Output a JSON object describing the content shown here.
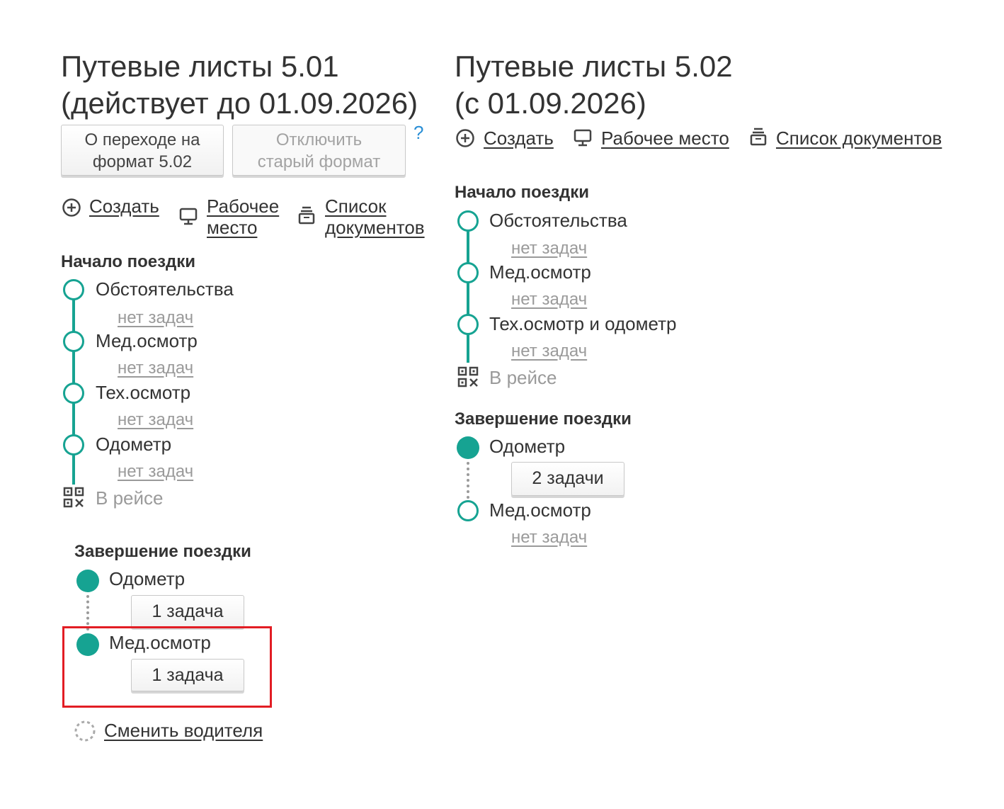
{
  "left": {
    "title_line1": "Путевые листы 5.01",
    "title_line2": "(действует до 01.09.2026)",
    "btn_transition_line1": "О переходе на",
    "btn_transition_line2": "формат 5.02",
    "btn_disable_line1": "Отключить",
    "btn_disable_line2": "старый формат",
    "help": "?",
    "create": "Создать",
    "workplace_line1": "Рабочее",
    "workplace_line2": "место",
    "doclist_line1": "Список",
    "doclist_line2": "документов",
    "start_section": "Начало поездки",
    "start_steps": [
      {
        "label": "Обстоятельства",
        "tasks": "нет задач"
      },
      {
        "label": "Мед.осмотр",
        "tasks": "нет задач"
      },
      {
        "label": "Тех.осмотр",
        "tasks": "нет задач"
      },
      {
        "label": "Одометр",
        "tasks": "нет задач"
      }
    ],
    "in_trip": "В рейсе",
    "end_section": "Завершение поездки",
    "end_steps": [
      {
        "label": "Одометр",
        "tasks": "1 задача"
      },
      {
        "label": "Мед.осмотр",
        "tasks": "1 задача"
      }
    ],
    "change_driver": "Сменить водителя"
  },
  "right": {
    "title_line1": "Путевые листы 5.02",
    "title_line2": "(с 01.09.2026)",
    "create": "Создать",
    "workplace": "Рабочее место",
    "doclist": "Список документов",
    "start_section": "Начало поездки",
    "start_steps": [
      {
        "label": "Обстоятельства",
        "tasks": "нет задач"
      },
      {
        "label": "Мед.осмотр",
        "tasks": "нет задач"
      },
      {
        "label": "Тех.осмотр и одометр",
        "tasks": "нет задач"
      }
    ],
    "in_trip": "В рейсе",
    "end_section": "Завершение поездки",
    "end_steps": [
      {
        "label": "Одометр",
        "tasks": "2 задачи"
      },
      {
        "label": "Мед.осмотр",
        "tasks": "нет задач"
      }
    ]
  },
  "colors": {
    "accent": "#16a392",
    "highlight": "#e21d24",
    "help": "#2b8fd6",
    "muted": "#9a9a9a"
  },
  "icons": [
    "plus-circle-icon",
    "monitor-icon",
    "document-stack-icon",
    "qr-code-icon",
    "spinner-icon"
  ]
}
